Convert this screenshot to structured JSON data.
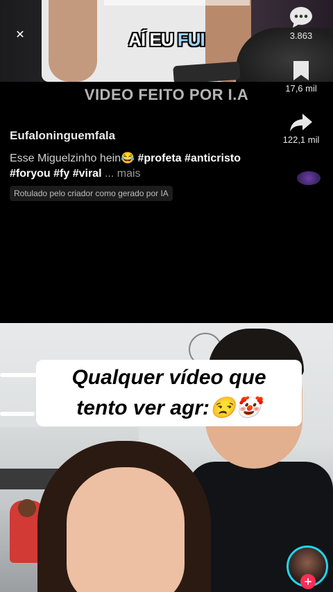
{
  "top_video": {
    "caption_part1": "AÍ EU ",
    "caption_part2": "FUI"
  },
  "ai_label": "VIDEO FEITO POR I.A",
  "actions": {
    "comments_count": "3.863",
    "saves_count": "17,6 mil",
    "shares_count": "122,1 mil"
  },
  "post": {
    "username": "Eufaloninguemfala",
    "description_text": "Esse Miguelzinho hein😂 ",
    "hashtags": [
      "#profeta",
      "#anticristo",
      "#foryou",
      "#fy",
      "#viral"
    ],
    "more_label": "... mais",
    "ai_badge": "Rotulado pelo criador como gerado por IA"
  },
  "bottom_video": {
    "caption_line1": "Qualquer vídeo que",
    "caption_line2": "tento ver agr:😒🤡"
  },
  "close_icon": "✕",
  "follow_icon": "+",
  "colors": {
    "accent_follow": "#fe2c55",
    "avatar_ring": "#20d5ec",
    "caption_highlight": "#9fd3ff"
  }
}
